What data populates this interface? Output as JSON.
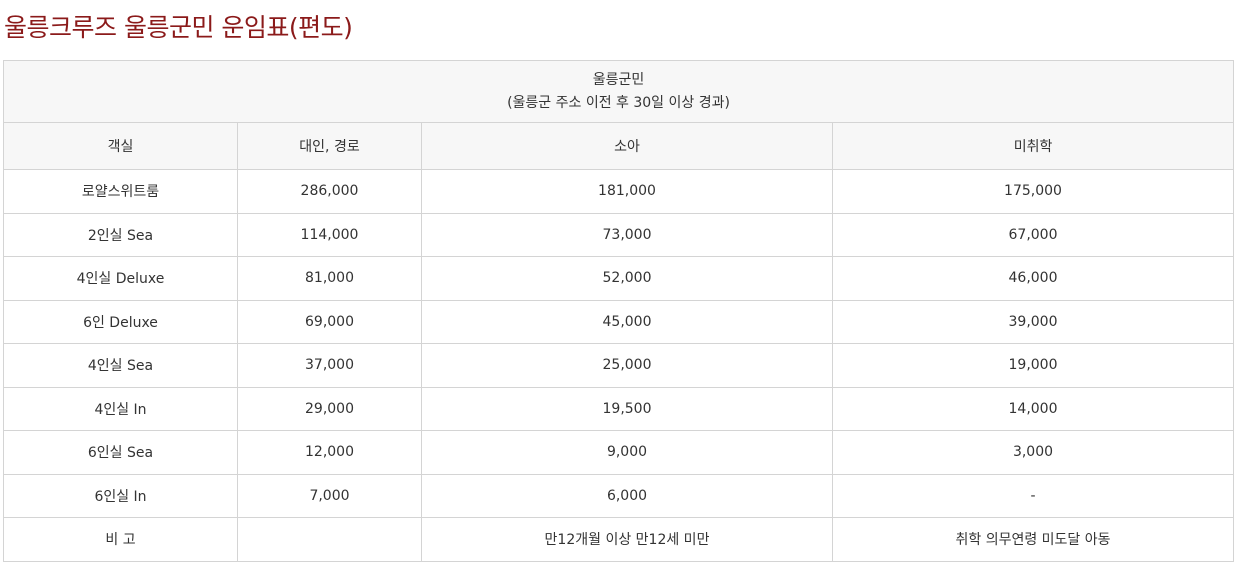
{
  "title": "울릉크루즈 울릉군민 운임표(편도)",
  "table": {
    "group_header": {
      "line1": "울릉군민",
      "line2": "(울릉군 주소 이전 후 30일 이상 경과)"
    },
    "columns": [
      "객실",
      "대인, 경로",
      "소아",
      "미취학"
    ],
    "rows": [
      [
        "로얄스위트룸",
        "286,000",
        "181,000",
        "175,000"
      ],
      [
        "2인실 Sea",
        "114,000",
        "73,000",
        "67,000"
      ],
      [
        "4인실 Deluxe",
        "81,000",
        "52,000",
        "46,000"
      ],
      [
        "6인 Deluxe",
        "69,000",
        "45,000",
        "39,000"
      ],
      [
        "4인실 Sea",
        "37,000",
        "25,000",
        "19,000"
      ],
      [
        "4인실 In",
        "29,000",
        "19,500",
        "14,000"
      ],
      [
        "6인실 Sea",
        "12,000",
        "9,000",
        "3,000"
      ],
      [
        "6인실 In",
        "7,000",
        "6,000",
        "-"
      ],
      [
        "비 고",
        "",
        "만12개월 이상 만12세 미만",
        "취학 의무연령 미도달 아동"
      ]
    ]
  },
  "colors": {
    "title": "#8b1a1a",
    "header_bg": "#f7f7f7",
    "border": "#d4d4d4",
    "text": "#333333"
  }
}
